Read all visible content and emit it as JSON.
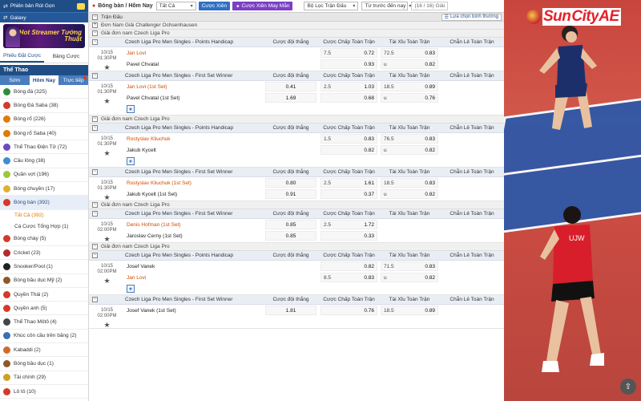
{
  "sidebar": {
    "top_title": "Phiên bản Rút Gọn",
    "galaxy": "Galaxy",
    "banner_text": "Hot Streamer Tướng Thuật",
    "tabs": [
      "Phiếu Đặt Cược",
      "Bảng Cược"
    ],
    "sport_header": "Thể Thao",
    "sub_tabs": [
      "Sớm",
      "Hôm Nay",
      "Trực tiếp"
    ],
    "items": [
      {
        "label": "Bóng đá (325)",
        "color": "#2e8b3a"
      },
      {
        "label": "Bóng Đá Saba (38)",
        "color": "#d23a2a"
      },
      {
        "label": "Bóng rổ (226)",
        "color": "#e07b00"
      },
      {
        "label": "Bóng rổ Saba (40)",
        "color": "#e07b00"
      },
      {
        "label": "Thể Thao Điện Tử (72)",
        "color": "#6a4bc5"
      },
      {
        "label": "Cầu lông (38)",
        "color": "#3a8fd0"
      },
      {
        "label": "Quần vợt (196)",
        "color": "#9bc93a"
      },
      {
        "label": "Bóng chuyền (17)",
        "color": "#e0b030"
      },
      {
        "label": "Bóng bàn (392)",
        "color": "#d23a2a"
      }
    ],
    "sub_items": [
      "Tất Cả (392)",
      "Cá Cược Tổng Hợp (1)"
    ],
    "items2": [
      {
        "label": "Bóng chày (5)",
        "color": "#d23a2a"
      },
      {
        "label": "Cricket (23)",
        "color": "#b32a2a"
      },
      {
        "label": "Snooker/Pool (1)",
        "color": "#222"
      },
      {
        "label": "Bóng bầu dục Mỹ (2)",
        "color": "#8a5a2a"
      },
      {
        "label": "Quyền Thái (2)",
        "color": "#d23a2a"
      },
      {
        "label": "Quyền anh (5)",
        "color": "#d23a2a"
      },
      {
        "label": "Thể Thao Môtô (4)",
        "color": "#444"
      },
      {
        "label": "Khúc côn cầu trên băng (2)",
        "color": "#3a6fb0"
      },
      {
        "label": "Kabaddi (2)",
        "color": "#d06a2a"
      },
      {
        "label": "Bóng bầu dục (1)",
        "color": "#8a5a2a"
      },
      {
        "label": "Tài chính (29)",
        "color": "#d0a020"
      },
      {
        "label": "Lô tô (10)",
        "color": "#d23a2a"
      }
    ]
  },
  "topbar": {
    "title": "Bóng bàn / Hôm Nay",
    "filter": "Tất Cả",
    "btn_cuoc_xien": "Cược Xiên",
    "btn_may_man": "Cược Xiên May Mắn",
    "filter_league": "Bộ Lọc Trận Đấu",
    "sort": "Từ trước đến nay",
    "pager": "(16 / 16) Giải"
  },
  "groups": {
    "g1": "Trận Đấu",
    "g2": "Đơn Nam Giải Challenger Ochsenhausen",
    "g3": "Giải đơn nam Czech Liga Pro",
    "expand": "Lựa chọn bình thường",
    "live": "Trận Đấu"
  },
  "columns": [
    "Cược đội thắng",
    "Cược Chấp Toàn Trận",
    "Tài Xỉu Toàn Trận",
    "Chẵn Lẻ Toàn Trận"
  ],
  "blocks": [
    {
      "league": "",
      "market": "Czech Liga Pro Men Singles - Points Handicap",
      "matches": [
        {
          "date": "10/15",
          "time": "01:30PM",
          "t1": "Jan Lovi",
          "t1fav": true,
          "t2": "Pavel Chvatal",
          "t2fav": false,
          "w1": "",
          "w2": "",
          "h1l": "7.5",
          "h1": "0.72",
          "h2l": "",
          "h2": "0.93",
          "o1l": "72.5",
          "o1": "0.83",
          "o2l": "u",
          "o2": "0.82",
          "fav": false
        }
      ]
    },
    {
      "league": "",
      "market": "Czech Liga Pro Men Singles - First Set Winner",
      "matches": [
        {
          "date": "10/15",
          "time": "01:30PM",
          "t1": "Jan Lovi (1st Set)",
          "t1fav": true,
          "t2": "Pavel Chvatal (1st Set)",
          "t2fav": false,
          "w1": "0.41",
          "w2": "1.69",
          "h1l": "2.5",
          "h1": "1.03",
          "h2l": "",
          "h2": "0.68",
          "o1l": "18.5",
          "o1": "0.89",
          "o2l": "u",
          "o2": "0.76",
          "fav": true
        }
      ]
    },
    {
      "league": "Giải đơn nam Czech Liga Pro",
      "market": "Czech Liga Pro Men Singles - Points Handicap",
      "matches": [
        {
          "date": "10/15",
          "time": "01:30PM",
          "t1": "Rostyslav Kliuchuk",
          "t1fav": true,
          "t2": "Jakub Kycelt",
          "t2fav": false,
          "w1": "",
          "w2": "",
          "h1l": "1.5",
          "h1": "0.83",
          "h2l": "",
          "h2": "0.82",
          "o1l": "76.5",
          "o1": "0.83",
          "o2l": "u",
          "o2": "0.82",
          "fav": true
        }
      ]
    },
    {
      "league": "",
      "market": "Czech Liga Pro Men Singles - First Set Winner",
      "matches": [
        {
          "date": "10/15",
          "time": "01:30PM",
          "t1": "Rostyslav Kliuchuk (1st Set)",
          "t1fav": true,
          "t2": "Jakub Kycelt (1st Set)",
          "t2fav": false,
          "w1": "0.80",
          "w2": "0.91",
          "h1l": "2.5",
          "h1": "1.61",
          "h2l": "",
          "h2": "0.37",
          "o1l": "18.5",
          "o1": "0.83",
          "o2l": "u",
          "o2": "0.82",
          "fav": false
        }
      ]
    },
    {
      "league": "Giải đơn nam Czech Liga Pro",
      "market": "Czech Liga Pro Men Singles - First Set Winner",
      "matches": [
        {
          "date": "10/15",
          "time": "02:00PM",
          "t1": "Denis Hofman (1st Set)",
          "t1fav": true,
          "t2": "Jaroslav Cerny (1st Set)",
          "t2fav": false,
          "w1": "0.85",
          "w2": "0.85",
          "h1l": "2.5",
          "h1": "1.72",
          "h2l": "",
          "h2": "0.33",
          "o1l": "",
          "o1": "",
          "o2l": "",
          "o2": "",
          "fav": false
        }
      ]
    },
    {
      "league": "Giải đơn nam Czech Liga Pro",
      "market": "Czech Liga Pro Men Singles - Points Handicap",
      "matches": [
        {
          "date": "10/15",
          "time": "02:00PM",
          "t1": "Josef Vanek",
          "t1fav": false,
          "t2": "Jan Lovi",
          "t2fav": true,
          "w1": "",
          "w2": "",
          "h1l": "",
          "h1": "0.82",
          "h2l": "8.5",
          "h2": "0.83",
          "o1l": "71.5",
          "o1": "0.83",
          "o2l": "u",
          "o2": "0.82",
          "fav": true
        }
      ]
    },
    {
      "league": "",
      "market": "Czech Liga Pro Men Singles - First Set Winner",
      "matches": [
        {
          "date": "10/15",
          "time": "02:00PM",
          "t1": "Josef Vanek (1st Set)",
          "t1fav": false,
          "t2": "",
          "t2fav": false,
          "w1": "1.81",
          "w2": "",
          "h1l": "",
          "h1": "0.76",
          "h2l": "",
          "h2": "",
          "o1l": "18.5",
          "o1": "0.89",
          "o2l": "",
          "o2": "",
          "fav": false
        }
      ]
    }
  ],
  "ad": {
    "logo_sun": "Sun",
    "logo_city": "City",
    "logo_ae": "AE"
  }
}
